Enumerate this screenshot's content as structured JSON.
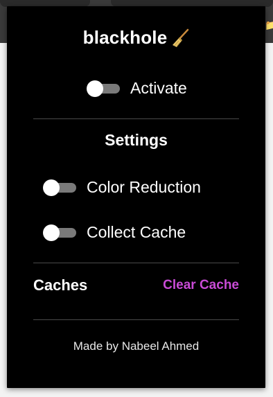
{
  "popup": {
    "title": "blackhole",
    "title_icon": "broom-icon",
    "activate": {
      "label": "Activate",
      "enabled": false
    },
    "settings": {
      "heading": "Settings",
      "options": [
        {
          "label": "Color Reduction",
          "enabled": false
        },
        {
          "label": "Collect Cache",
          "enabled": false
        }
      ]
    },
    "caches": {
      "label": "Caches",
      "clear_label": "Clear Cache"
    },
    "footer": "Made by Nabeel Ahmed",
    "colors": {
      "background": "#000000",
      "accent": "#c94bd6",
      "toggle_track": "#7a7a7a",
      "toggle_knob": "#ffffff"
    }
  }
}
